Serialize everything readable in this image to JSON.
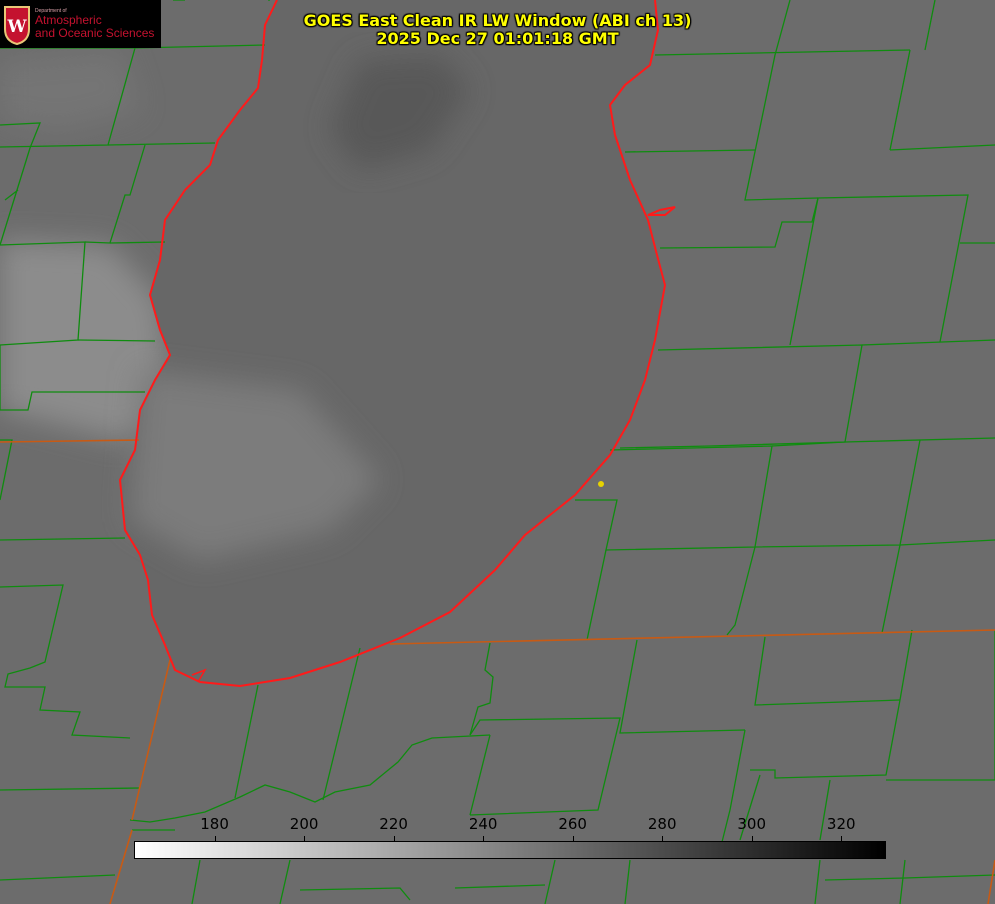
{
  "title": {
    "line1": "GOES East Clean IR LW Window (ABI ch 13)",
    "line2": "2025 Dec 27 01:01:18 GMT"
  },
  "logo": {
    "department": "Department of",
    "line1": "Atmospheric",
    "line2": "and Oceanic Sciences",
    "crest_letter": "W"
  },
  "colorbar": {
    "min": 162,
    "max": 330,
    "ticks": [
      "180",
      "200",
      "220",
      "240",
      "260",
      "280",
      "300",
      "320"
    ],
    "gradient_from": "#ffffff",
    "gradient_to": "#000000"
  },
  "colors": {
    "county_lines": "#0f8c0f",
    "lake_outline": "#ff1a1a",
    "state_lines": "#c85a14",
    "title_text": "#ffff00",
    "marker": "#e6d200"
  }
}
